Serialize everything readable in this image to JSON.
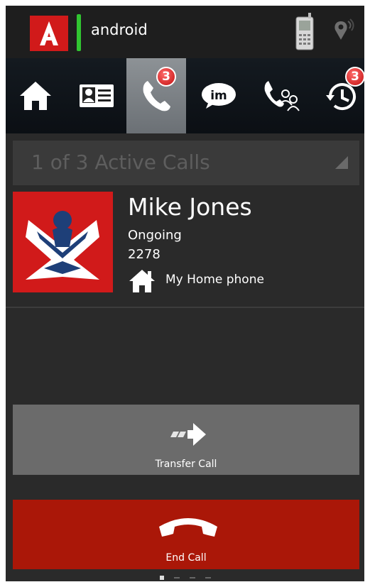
{
  "status_bar": {
    "username": "android",
    "icons": [
      "app-logo-icon",
      "presence-indicator",
      "mobile-phone-icon",
      "location-signal-icon"
    ]
  },
  "tabs": [
    {
      "name": "home",
      "icon": "home-icon"
    },
    {
      "name": "contacts",
      "icon": "contact-card-icon"
    },
    {
      "name": "calls",
      "icon": "phone-handset-icon",
      "badge": "3",
      "active": true
    },
    {
      "name": "im",
      "icon": "im-chat-bubble-icon",
      "icon_text": "im"
    },
    {
      "name": "conference",
      "icon": "conference-call-icon"
    },
    {
      "name": "history",
      "icon": "call-history-icon",
      "badge": "3"
    }
  ],
  "active_calls": {
    "label": "1 of 3 Active Calls"
  },
  "contact": {
    "name": "Mike Jones",
    "status": "Ongoing",
    "number": "2278",
    "phone_label": "My Home phone"
  },
  "buttons": {
    "transfer": "Transfer Call",
    "end_call": "End Call"
  },
  "pager": {
    "current": 1,
    "total": 4
  },
  "colors": {
    "brand_red": "#d11a1a",
    "end_call_red": "#aa1708",
    "presence_green": "#31c531",
    "badge_red": "#c21010"
  }
}
